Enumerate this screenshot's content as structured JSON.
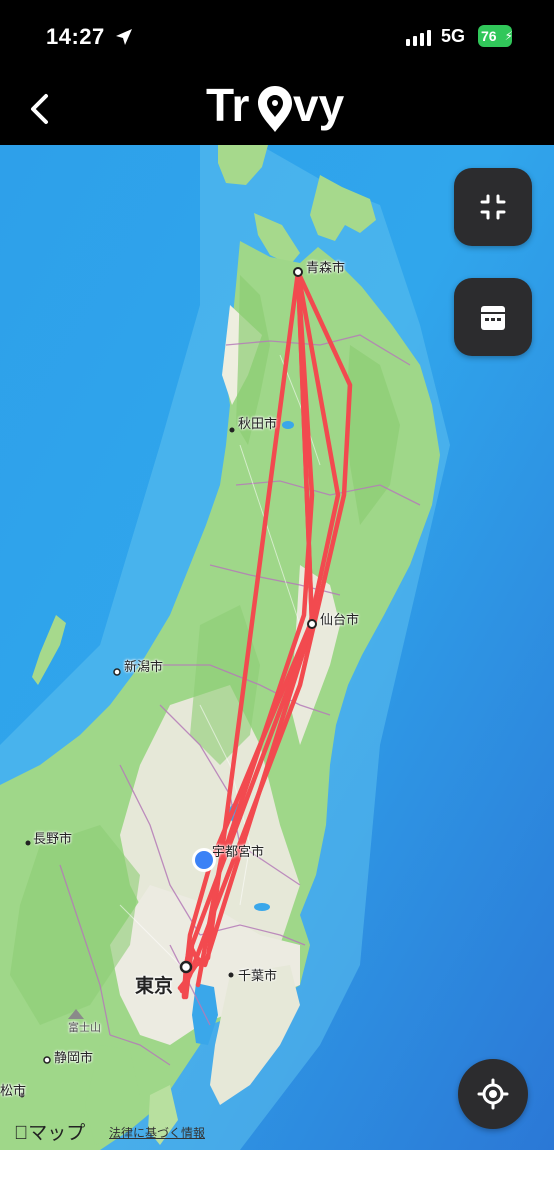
{
  "status_bar": {
    "time": "14:27",
    "network": "5G",
    "battery": "76"
  },
  "nav": {
    "logo_text": "Trovy",
    "back_icon": "chevron-left-icon"
  },
  "map": {
    "cities": [
      {
        "id": "aomori",
        "name": "青森市"
      },
      {
        "id": "akita",
        "name": "秋田市"
      },
      {
        "id": "sendai",
        "name": "仙台市"
      },
      {
        "id": "niigata",
        "name": "新潟市"
      },
      {
        "id": "nagano",
        "name": "長野市"
      },
      {
        "id": "utsunomiya",
        "name": "宇都宮市"
      },
      {
        "id": "tokyo",
        "name": "東京"
      },
      {
        "id": "chiba",
        "name": "千葉市"
      },
      {
        "id": "shizuoka",
        "name": "静岡市"
      },
      {
        "id": "hamamatsu",
        "name": "松市"
      },
      {
        "id": "fuji",
        "name": "富士山"
      }
    ],
    "route_color": "#f24a4f",
    "current_location_color": "#3b82f6"
  },
  "controls": {
    "collapse_icon": "collapse-icon",
    "calendar_icon": "calendar-icon",
    "locate_icon": "crosshair-icon"
  },
  "attribution": {
    "maps_label": "マップ",
    "legal_link": "法律に基づく情報"
  }
}
